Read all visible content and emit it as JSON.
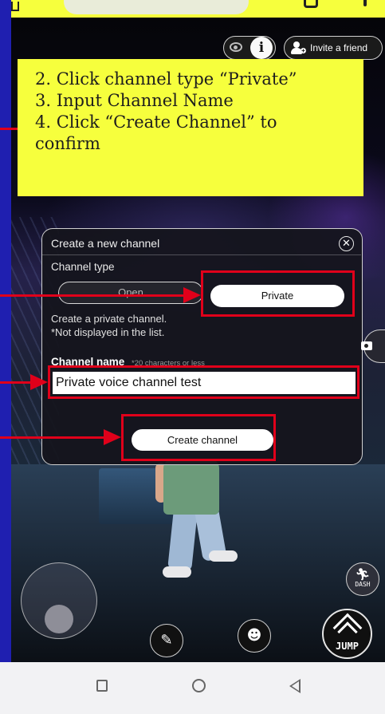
{
  "instruction": {
    "line1": "2. Click channel type “Private”",
    "line2": "3. Input Channel Name",
    "line3": "4. Click “Create Channel” to",
    "line4": "confirm"
  },
  "header": {
    "invite_label": "Invite a friend",
    "info_glyph": "i"
  },
  "dialog": {
    "title": "Create a new channel",
    "close_glyph": "✕",
    "channel_type_label": "Channel type",
    "option_open": "Open",
    "option_private": "Private",
    "desc_line1": "Create a private channel.",
    "desc_line2": "*Not displayed in the list.",
    "channel_name_label": "Channel name",
    "channel_name_hint": "*20 characters or less",
    "channel_name_value": "Private voice channel test",
    "create_button": "Create channel"
  },
  "controls": {
    "dash_label": "DASH",
    "jump_label": "JUMP"
  },
  "colors": {
    "highlight": "#e0001a",
    "instruction_bg": "#f6ff3d"
  },
  "icons": [
    "eye-icon",
    "info-icon",
    "add-person-icon",
    "close-icon",
    "camera-icon",
    "dash-run-icon",
    "jump-chevron-icon",
    "chat-pencil-icon",
    "emote-face-icon",
    "nav-recents-icon",
    "nav-home-icon",
    "nav-back-icon"
  ]
}
